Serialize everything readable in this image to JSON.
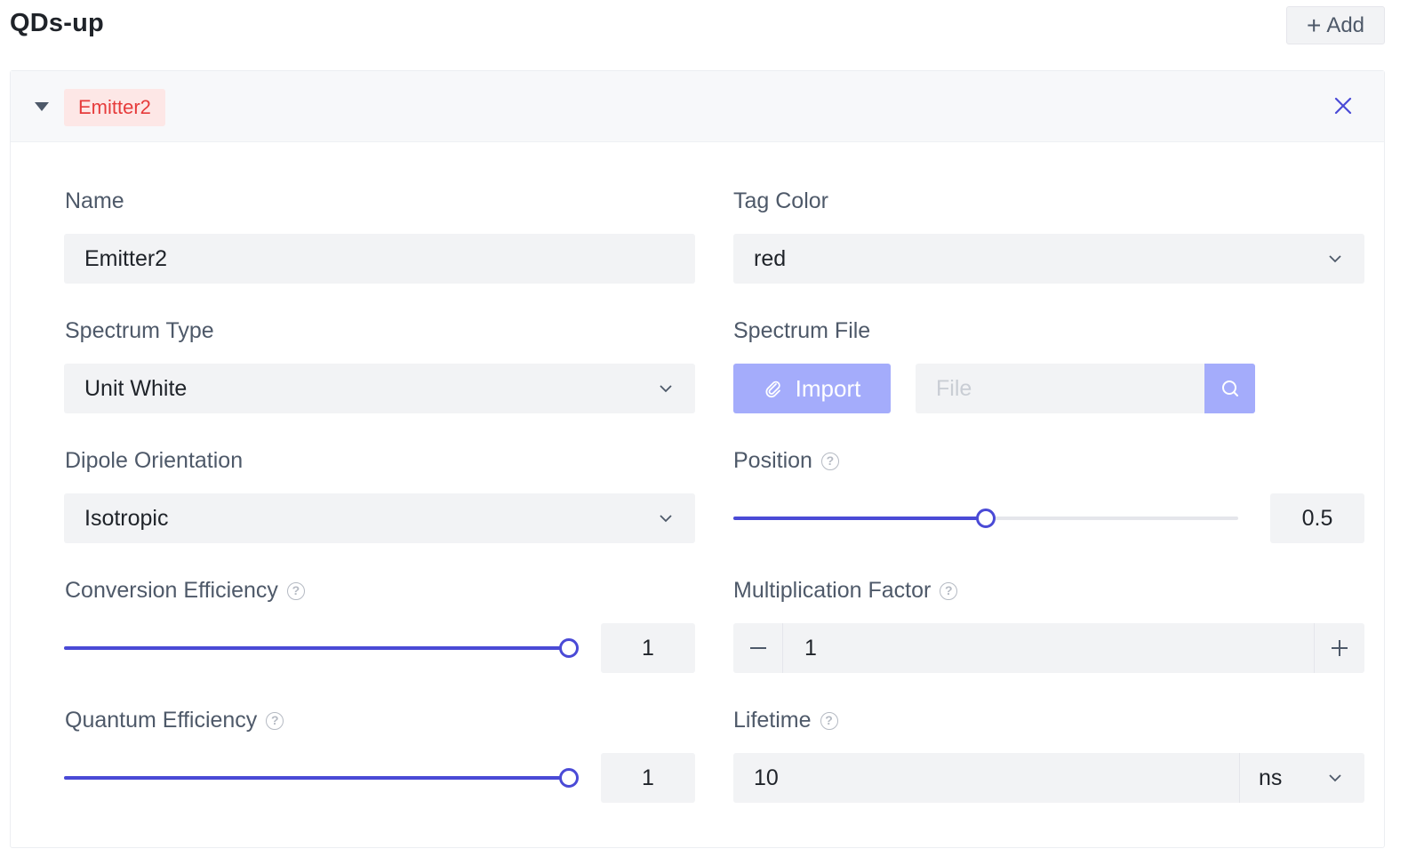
{
  "header": {
    "title": "QDs-up",
    "add_label": "Add"
  },
  "emitter": {
    "tag_label": "Emitter2",
    "name": {
      "label": "Name",
      "value": "Emitter2"
    },
    "tag_color": {
      "label": "Tag Color",
      "value": "red"
    },
    "spectrum_type": {
      "label": "Spectrum Type",
      "value": "Unit White"
    },
    "spectrum_file": {
      "label": "Spectrum File",
      "import_label": "Import",
      "placeholder": "File"
    },
    "dipole_orientation": {
      "label": "Dipole Orientation",
      "value": "Isotropic"
    },
    "position": {
      "label": "Position",
      "value": "0.5",
      "slider_fraction": 0.5
    },
    "conversion_efficiency": {
      "label": "Conversion Efficiency",
      "value": "1",
      "slider_fraction": 1.0
    },
    "multiplication_factor": {
      "label": "Multiplication Factor",
      "value": "1"
    },
    "quantum_efficiency": {
      "label": "Quantum Efficiency",
      "value": "1",
      "slider_fraction": 1.0
    },
    "lifetime": {
      "label": "Lifetime",
      "value": "10",
      "unit": "ns"
    }
  },
  "colors": {
    "accent": "#4a4ad6",
    "accent_light": "#a4acfb",
    "tag_bg": "#fde7e6",
    "tag_text": "#e63b3b",
    "field_bg": "#f2f3f5"
  }
}
